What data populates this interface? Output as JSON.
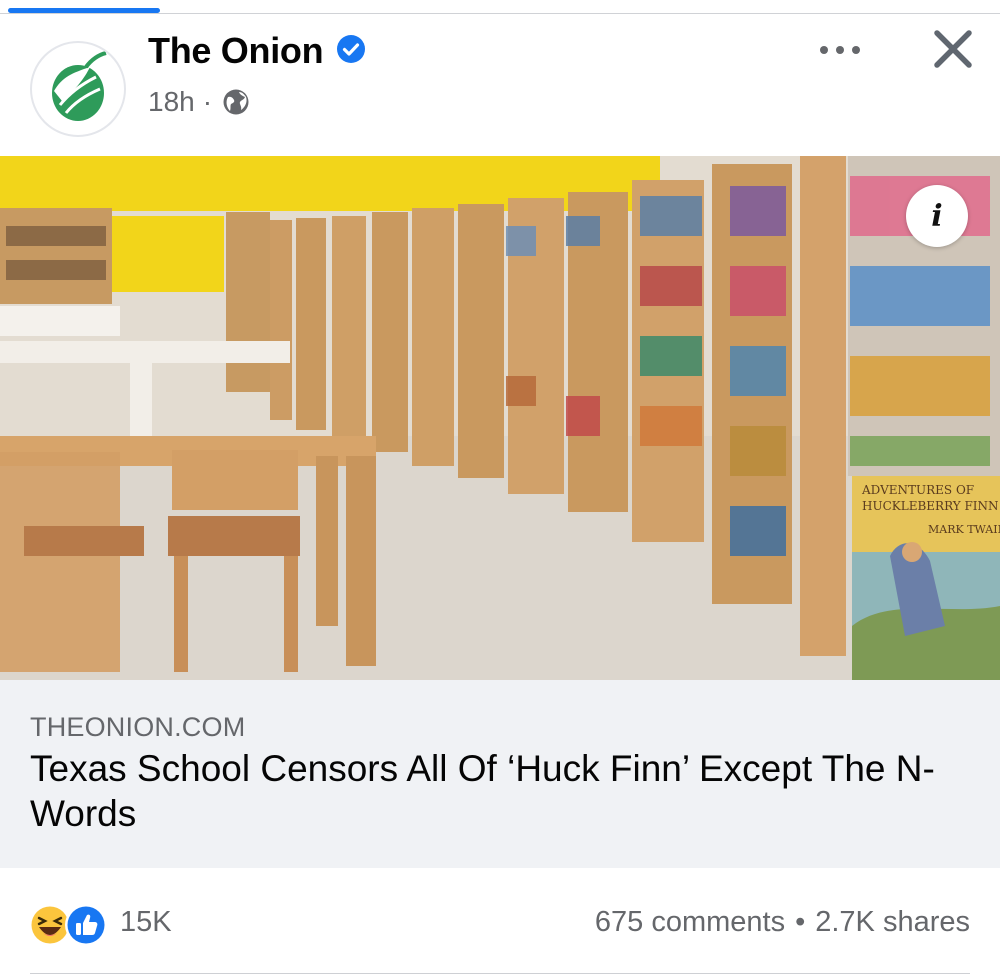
{
  "post": {
    "page_name": "The Onion",
    "time": "18h",
    "separator": "·"
  },
  "link_preview": {
    "domain": "THEONION.COM",
    "headline": "Texas School Censors All Of ‘Huck Finn’ Except The N-Words",
    "info_label": "i"
  },
  "book_cover": {
    "title_line1": "ADVENTURES OF",
    "title_line2": "HUCKLEBERRY FINN",
    "author": "MARK TWAIN"
  },
  "engagement": {
    "reaction_count": "15K",
    "comments": "675 comments",
    "dot": "•",
    "shares": "2.7K shares"
  },
  "colors": {
    "accent": "#1877f2",
    "brand_green": "#1e8f4e",
    "muted_text": "#65676b"
  },
  "icons": [
    "onion-logo",
    "verified-badge-icon",
    "globe-icon",
    "more-icon",
    "close-icon",
    "info-icon",
    "haha-reaction-icon",
    "like-reaction-icon"
  ]
}
